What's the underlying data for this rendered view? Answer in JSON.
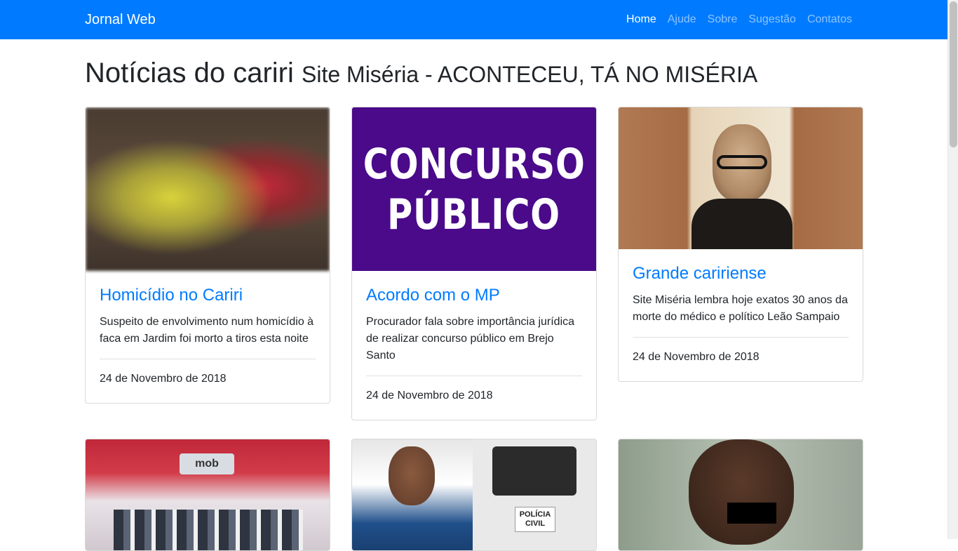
{
  "navbar": {
    "brand": "Jornal Web",
    "links": [
      "Home",
      "Ajude",
      "Sobre",
      "Sugestão",
      "Contatos"
    ]
  },
  "header": {
    "title": "Notícias do cariri",
    "subtitle": "Site Miséria - ACONTECEU, TÁ NO MISÉRIA"
  },
  "cards": [
    {
      "title": "Homicídio no Cariri",
      "text": "Suspeito de envolvimento num homicídio à faca em Jardim foi morto a tiros esta noite",
      "date": "24 de Novembro de 2018"
    },
    {
      "title": "Acordo com o MP",
      "text": "Procurador fala sobre importância jurídica de realizar concurso público em Brejo Santo",
      "date": "24 de Novembro de 2018",
      "image_text": [
        "CONCURSO",
        "PÚBLICO"
      ]
    },
    {
      "title": "Grande caririense",
      "text": "Site Miséria lembra hoje exatos 30 anos da morte do médico e político Leão Sampaio",
      "date": "24 de Novembro de 2018"
    }
  ],
  "images_row2": {
    "event_sign": "mob",
    "police_label": "POLÍCIA CIVIL"
  }
}
